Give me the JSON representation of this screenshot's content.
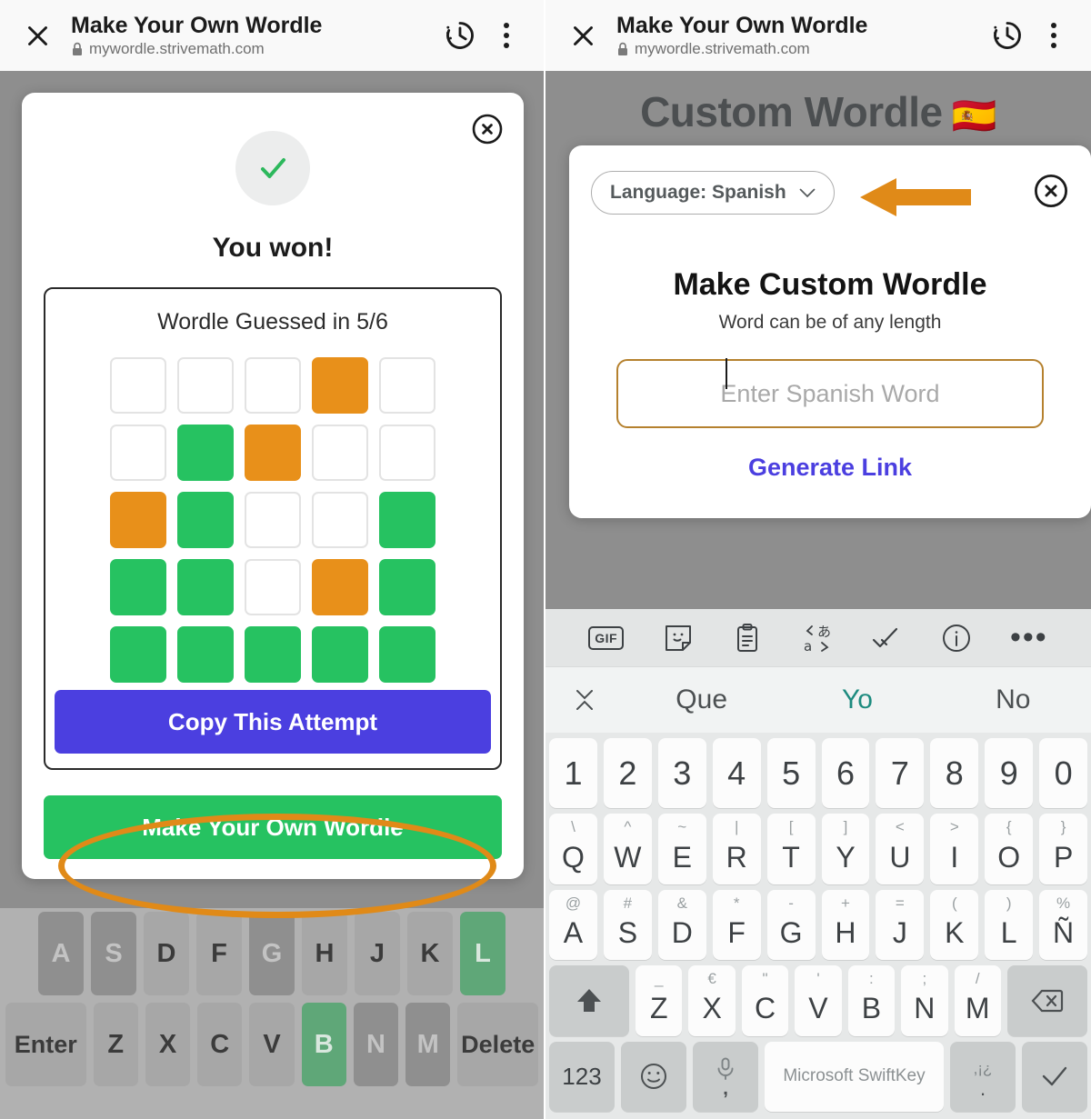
{
  "browser": {
    "title": "Make Your Own Wordle",
    "url": "mywordle.strivemath.com",
    "close_icon": "close-x-icon",
    "history_icon": "history-clock-icon",
    "menu_icon": "kebab-menu-icon",
    "lock_icon": "lock-icon"
  },
  "left_screen": {
    "dialog": {
      "close_label": "×",
      "status_icon": "green-check-icon",
      "heading": "You won!",
      "result_text": "Wordle Guessed in 5/6",
      "copy_button": "Copy This Attempt",
      "make_button": "Make Your Own Wordle",
      "annotation": "orange-ellipse-highlight"
    },
    "colors": {
      "green": "#26c261",
      "orange": "#e8901a",
      "copy_button": "#4b3fe0",
      "make_button": "#26c261",
      "annotation": "#e08a18"
    },
    "grid": [
      [
        "empty",
        "empty",
        "empty",
        "orange",
        "empty"
      ],
      [
        "empty",
        "green",
        "orange",
        "empty",
        "empty"
      ],
      [
        "orange",
        "green",
        "empty",
        "empty",
        "green"
      ],
      [
        "green",
        "green",
        "empty",
        "orange",
        "green"
      ],
      [
        "green",
        "green",
        "green",
        "green",
        "green"
      ]
    ],
    "game_keyboard": {
      "row_home": [
        {
          "label": "A",
          "state": "used"
        },
        {
          "label": "S",
          "state": "used"
        },
        {
          "label": "D",
          "state": "absent"
        },
        {
          "label": "F",
          "state": "absent"
        },
        {
          "label": "G",
          "state": "used"
        },
        {
          "label": "H",
          "state": "absent"
        },
        {
          "label": "J",
          "state": "absent"
        },
        {
          "label": "K",
          "state": "absent"
        },
        {
          "label": "L",
          "state": "correct"
        }
      ],
      "row_bottom": [
        {
          "label": "Enter",
          "state": "absent",
          "wide": true
        },
        {
          "label": "Z",
          "state": "absent"
        },
        {
          "label": "X",
          "state": "absent"
        },
        {
          "label": "C",
          "state": "absent"
        },
        {
          "label": "V",
          "state": "absent"
        },
        {
          "label": "B",
          "state": "correct"
        },
        {
          "label": "N",
          "state": "used"
        },
        {
          "label": "M",
          "state": "used"
        },
        {
          "label": "Delete",
          "state": "absent",
          "wide": true
        }
      ]
    }
  },
  "right_screen": {
    "page_title": "Custom Wordle",
    "page_title_flag": "🇪🇸",
    "dialog": {
      "language_label": "Language: Spanish",
      "language_chevron_icon": "chevron-down-icon",
      "arrow_annotation_icon": "left-arrow-annotation-icon",
      "close_icon": "close-circle-icon",
      "heading": "Make Custom Wordle",
      "subheading": "Word can be of any length",
      "input_placeholder": "Enter Spanish Word",
      "input_value": "",
      "generate_link": "Generate Link"
    },
    "colors": {
      "input_border": "#b5812e",
      "generate_link": "#4b3fe0",
      "arrow": "#e08a18",
      "title": "#4c4f51"
    },
    "keyboard": {
      "toolbar": [
        "gif-icon",
        "sticker-icon",
        "clipboard-icon",
        "translate-icon",
        "edit-check-icon",
        "info-icon",
        "more-dots-icon"
      ],
      "toolbar_gif_label": "GIF",
      "suggestions": [
        {
          "text": "Que",
          "active": false
        },
        {
          "text": "Yo",
          "active": true
        },
        {
          "text": "No",
          "active": false
        }
      ],
      "collapse_icon": "collapse-chevrons-icon",
      "row_numbers": [
        "1",
        "2",
        "3",
        "4",
        "5",
        "6",
        "7",
        "8",
        "9",
        "0"
      ],
      "row_top": [
        {
          "alt": "\\",
          "key": "Q"
        },
        {
          "alt": "^",
          "key": "W"
        },
        {
          "alt": "~",
          "key": "E"
        },
        {
          "alt": "|",
          "key": "R"
        },
        {
          "alt": "[",
          "key": "T"
        },
        {
          "alt": "]",
          "key": "Y"
        },
        {
          "alt": "<",
          "key": "U"
        },
        {
          "alt": ">",
          "key": "I"
        },
        {
          "alt": "{",
          "key": "O"
        },
        {
          "alt": "}",
          "key": "P"
        }
      ],
      "row_home": [
        {
          "alt": "@",
          "key": "A"
        },
        {
          "alt": "#",
          "key": "S"
        },
        {
          "alt": "&",
          "key": "D"
        },
        {
          "alt": "*",
          "key": "F"
        },
        {
          "alt": "-",
          "key": "G"
        },
        {
          "alt": "+",
          "key": "H"
        },
        {
          "alt": "=",
          "key": "J"
        },
        {
          "alt": "(",
          "key": "K"
        },
        {
          "alt": ")",
          "key": "L"
        },
        {
          "alt": "%",
          "key": "Ñ"
        }
      ],
      "row_bottom": [
        {
          "alt": "_",
          "key": "Z"
        },
        {
          "alt": "€",
          "key": "X"
        },
        {
          "alt": "\"",
          "key": "C"
        },
        {
          "alt": "'",
          "key": "V"
        },
        {
          "alt": ":",
          "key": "B"
        },
        {
          "alt": ";",
          "key": "N"
        },
        {
          "alt": "/",
          "key": "M"
        }
      ],
      "shift_icon": "shift-up-arrow-icon",
      "backspace_icon": "backspace-delete-icon",
      "numeric_key": "123",
      "emoji_icon": "emoji-smiley-icon",
      "mic_icon": "microphone-icon",
      "mic_alt": ",",
      "space_label": "Microsoft SwiftKey",
      "punctuation_top": ",¡¿",
      "punctuation_bottom": ".",
      "enter_icon": "checkmark-enter-icon"
    }
  }
}
